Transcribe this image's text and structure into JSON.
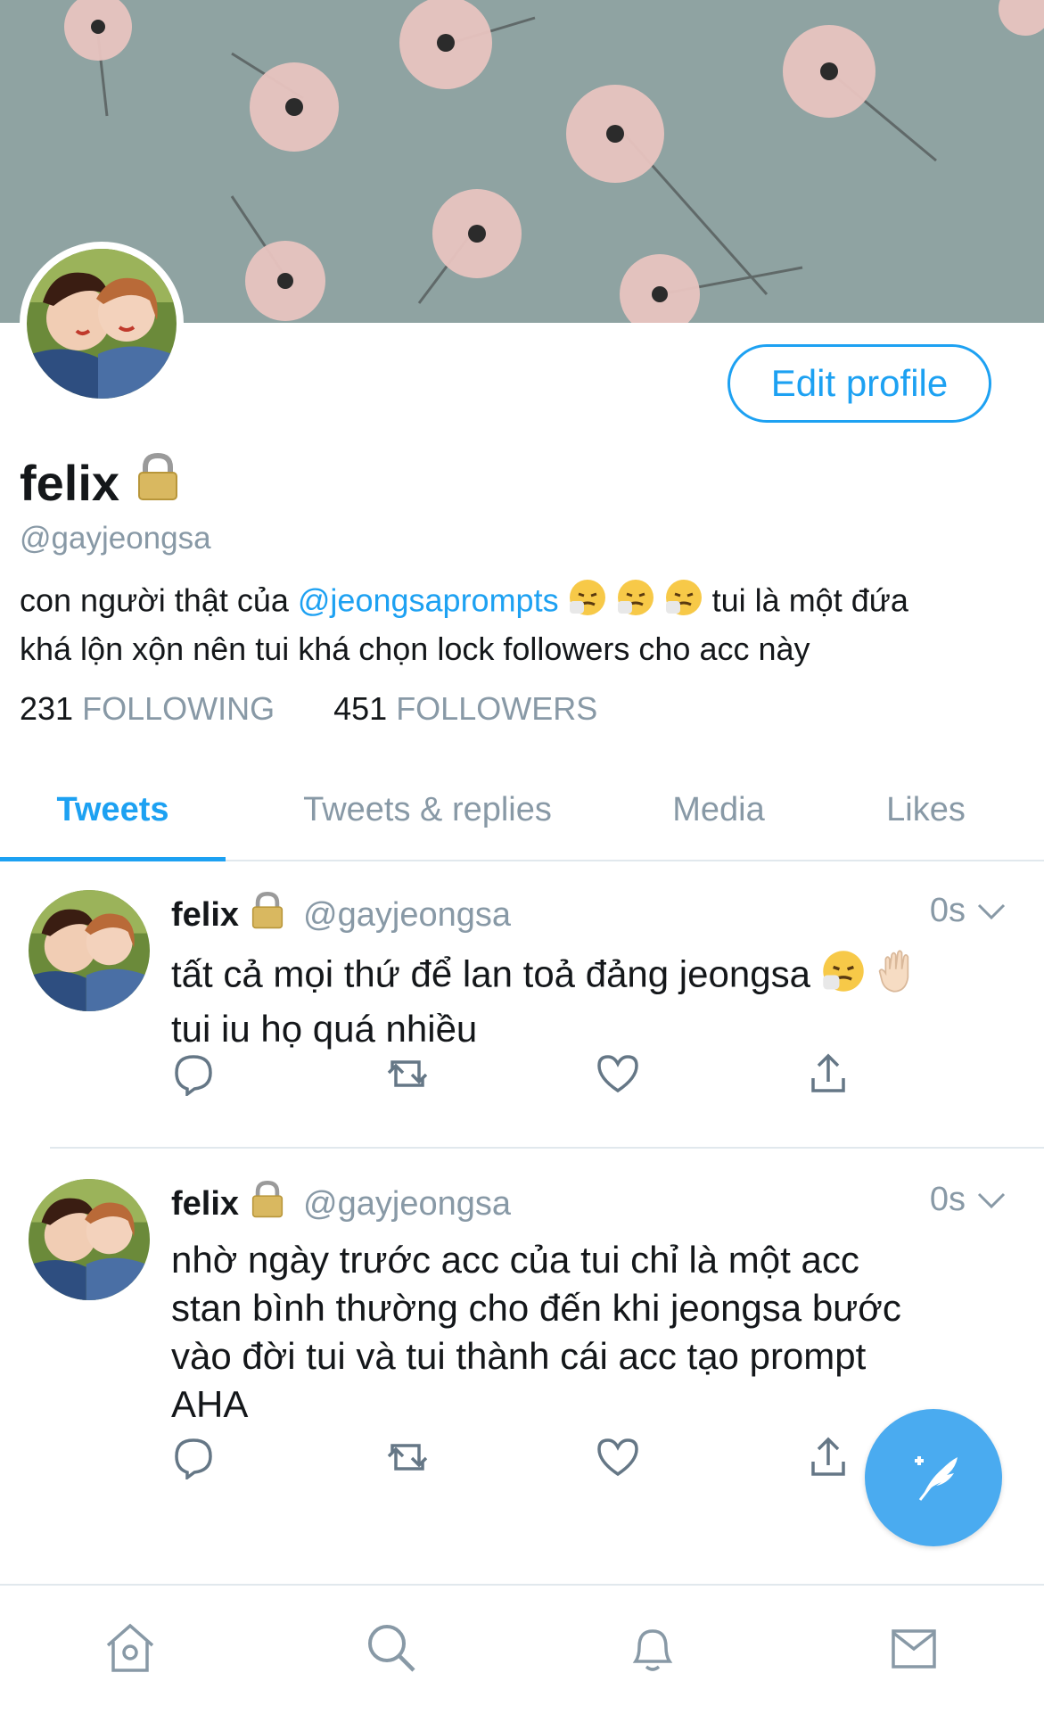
{
  "profile": {
    "name": "felix",
    "handle": "@gayjeongsa",
    "edit_label": "Edit profile",
    "bio_prefix": "con người thật của ",
    "bio_mention": "@jeongsaprompts",
    "bio_middle": " tui là một đứa",
    "bio_line2": "khá lộn xộn nên tui khá chọn lock followers cho acc này",
    "following_count": "231",
    "following_label": "FOLLOWING",
    "followers_count": "451",
    "followers_label": "FOLLOWERS"
  },
  "tabs": [
    "Tweets",
    "Tweets & replies",
    "Media",
    "Likes"
  ],
  "tweets": [
    {
      "name": "felix",
      "handle": "@gayjeongsa",
      "time": "0s",
      "line1": "tất cả mọi thứ để lan toả đảng jeongsa",
      "line2": "tui iu họ quá nhiều"
    },
    {
      "name": "felix",
      "handle": "@gayjeongsa",
      "time": "0s",
      "line1": "nhờ ngày trước acc của tui chỉ là một acc",
      "line2": "stan bình thường cho đến khi jeongsa bước",
      "line3": "vào đời tui và tui thành cái acc tạo prompt",
      "line4": "AHA"
    }
  ],
  "icons": {
    "lock": "lock-icon",
    "sneeze_face": "sneezing-face-emoji",
    "raised_hand": "raised-hand-emoji",
    "reply": "reply-icon",
    "retweet": "retweet-icon",
    "like": "heart-icon",
    "share": "share-icon",
    "compose": "compose-tweet-icon",
    "home": "home-icon",
    "search": "search-icon",
    "notifications": "bell-icon",
    "messages": "mail-icon"
  },
  "colors": {
    "accent": "#1da1f2",
    "muted": "#8899a6",
    "fab": "#4aabf0",
    "banner": "#8fa3a2"
  }
}
